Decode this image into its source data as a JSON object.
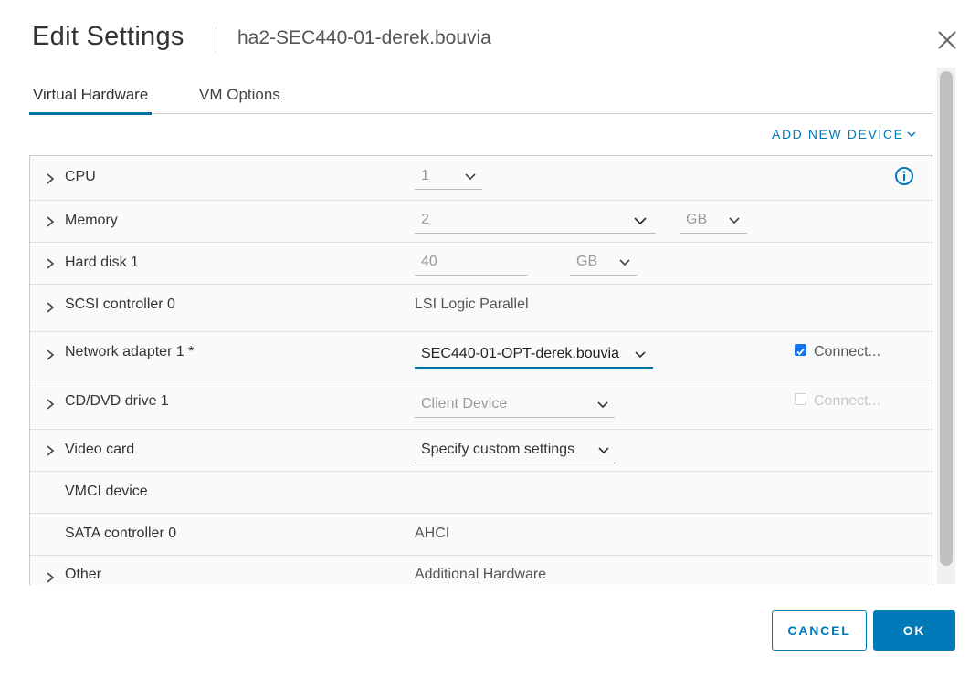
{
  "dialog": {
    "title": "Edit Settings",
    "vm_name": "ha2-SEC440-01-derek.bouvia"
  },
  "tabs": [
    {
      "label": "Virtual Hardware",
      "active": true
    },
    {
      "label": "VM Options",
      "active": false
    }
  ],
  "add_new_device_label": "ADD NEW DEVICE",
  "hardware": {
    "cpu": {
      "label": "CPU",
      "value": "1"
    },
    "memory": {
      "label": "Memory",
      "value": "2",
      "unit": "GB"
    },
    "hard_disk": {
      "label": "Hard disk 1",
      "value": "40",
      "unit": "GB"
    },
    "scsi": {
      "label": "SCSI controller 0",
      "value": "LSI Logic Parallel"
    },
    "network": {
      "label": "Network adapter 1 *",
      "value": "SEC440-01-OPT-derek.bouvia",
      "connect_label": "Connect...",
      "connected": true
    },
    "cdrom": {
      "label": "CD/DVD drive 1",
      "value": "Client Device",
      "connect_label": "Connect...",
      "connected": false
    },
    "video": {
      "label": "Video card",
      "value": "Specify custom settings"
    },
    "vmci": {
      "label": "VMCI device"
    },
    "sata": {
      "label": "SATA controller 0",
      "value": "AHCI"
    },
    "other": {
      "label": "Other",
      "value": "Additional Hardware"
    }
  },
  "buttons": {
    "cancel": "CANCEL",
    "ok": "OK"
  },
  "colors": {
    "accent": "#0079b8",
    "checkbox": "#1a73e8"
  }
}
